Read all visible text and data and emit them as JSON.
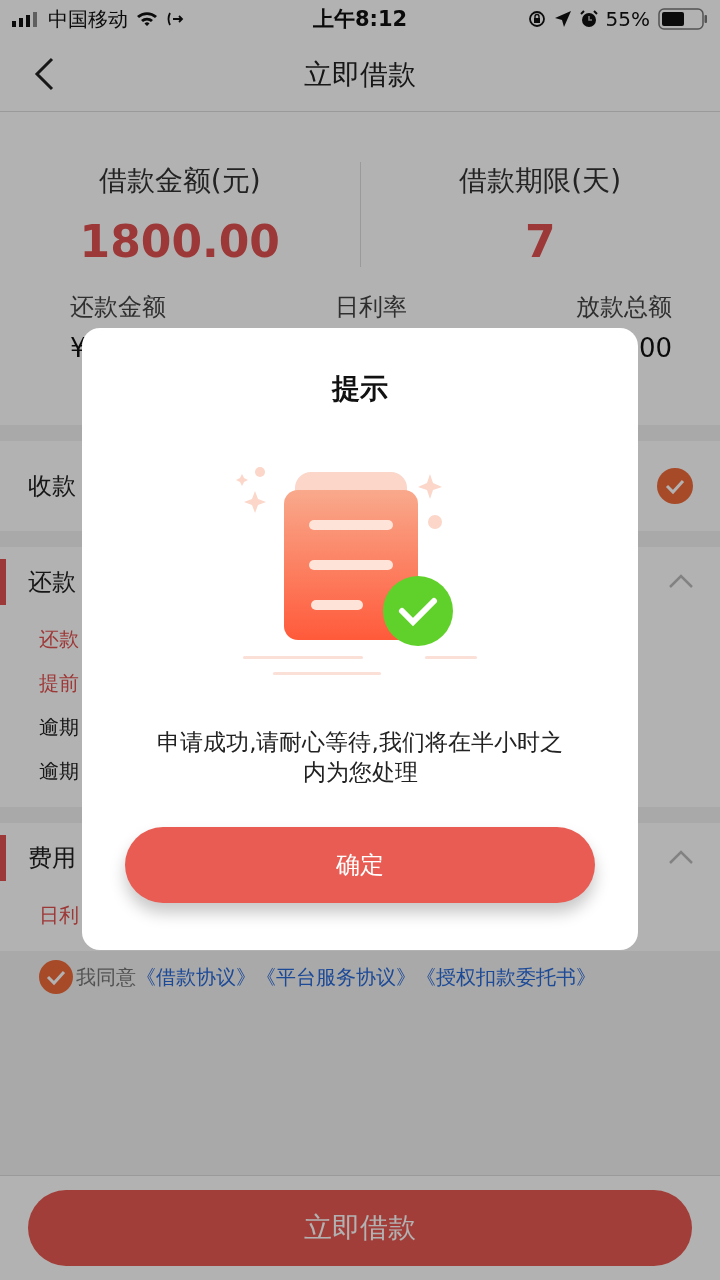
{
  "status_bar": {
    "carrier": "中国移动",
    "time": "上午8:12",
    "battery": "55%"
  },
  "nav": {
    "title": "立即借款"
  },
  "summary": {
    "primary": [
      {
        "label": "借款金额(元)",
        "value": "1800.00"
      },
      {
        "label": "借款期限(天)",
        "value": "7"
      }
    ],
    "stats": [
      {
        "label": "还款金额",
        "value": "¥"
      },
      {
        "label": "日利率"
      },
      {
        "label": "放款总额",
        "value": "00"
      }
    ]
  },
  "receiving_account": {
    "label": "收款",
    "checked": true
  },
  "sections": [
    {
      "title": "还款",
      "expanded": true,
      "items": [
        {
          "text": "还款",
          "highlighted": true
        },
        {
          "text": "提前",
          "highlighted": true
        },
        {
          "text": "逾期",
          "highlighted": false
        },
        {
          "text": "逾期",
          "highlighted": false
        }
      ]
    },
    {
      "title": "费用",
      "expanded": true,
      "items": [
        {
          "text": "日利",
          "highlighted": true
        }
      ]
    }
  ],
  "agreement": {
    "checked": true,
    "prefix": "我同意",
    "links": [
      "《借款协议》",
      "《平台服务协议》",
      "《授权扣款委托书》"
    ]
  },
  "submit_button": "立即借款",
  "dialog": {
    "title": "提示",
    "message": "申请成功,请耐心等待,我们将在半小时之内为您处理",
    "button": "确定"
  }
}
